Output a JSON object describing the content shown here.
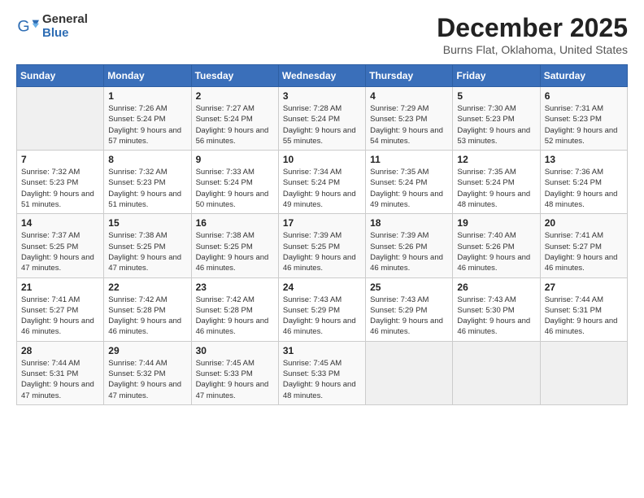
{
  "logo": {
    "general": "General",
    "blue": "Blue"
  },
  "title": "December 2025",
  "location": "Burns Flat, Oklahoma, United States",
  "days_of_week": [
    "Sunday",
    "Monday",
    "Tuesday",
    "Wednesday",
    "Thursday",
    "Friday",
    "Saturday"
  ],
  "weeks": [
    [
      {
        "day": "",
        "info": ""
      },
      {
        "day": "1",
        "info": "Sunrise: 7:26 AM\nSunset: 5:24 PM\nDaylight: 9 hours and 57 minutes."
      },
      {
        "day": "2",
        "info": "Sunrise: 7:27 AM\nSunset: 5:24 PM\nDaylight: 9 hours and 56 minutes."
      },
      {
        "day": "3",
        "info": "Sunrise: 7:28 AM\nSunset: 5:24 PM\nDaylight: 9 hours and 55 minutes."
      },
      {
        "day": "4",
        "info": "Sunrise: 7:29 AM\nSunset: 5:23 PM\nDaylight: 9 hours and 54 minutes."
      },
      {
        "day": "5",
        "info": "Sunrise: 7:30 AM\nSunset: 5:23 PM\nDaylight: 9 hours and 53 minutes."
      },
      {
        "day": "6",
        "info": "Sunrise: 7:31 AM\nSunset: 5:23 PM\nDaylight: 9 hours and 52 minutes."
      }
    ],
    [
      {
        "day": "7",
        "info": "Sunrise: 7:32 AM\nSunset: 5:23 PM\nDaylight: 9 hours and 51 minutes."
      },
      {
        "day": "8",
        "info": "Sunrise: 7:32 AM\nSunset: 5:23 PM\nDaylight: 9 hours and 51 minutes."
      },
      {
        "day": "9",
        "info": "Sunrise: 7:33 AM\nSunset: 5:24 PM\nDaylight: 9 hours and 50 minutes."
      },
      {
        "day": "10",
        "info": "Sunrise: 7:34 AM\nSunset: 5:24 PM\nDaylight: 9 hours and 49 minutes."
      },
      {
        "day": "11",
        "info": "Sunrise: 7:35 AM\nSunset: 5:24 PM\nDaylight: 9 hours and 49 minutes."
      },
      {
        "day": "12",
        "info": "Sunrise: 7:35 AM\nSunset: 5:24 PM\nDaylight: 9 hours and 48 minutes."
      },
      {
        "day": "13",
        "info": "Sunrise: 7:36 AM\nSunset: 5:24 PM\nDaylight: 9 hours and 48 minutes."
      }
    ],
    [
      {
        "day": "14",
        "info": "Sunrise: 7:37 AM\nSunset: 5:25 PM\nDaylight: 9 hours and 47 minutes."
      },
      {
        "day": "15",
        "info": "Sunrise: 7:38 AM\nSunset: 5:25 PM\nDaylight: 9 hours and 47 minutes."
      },
      {
        "day": "16",
        "info": "Sunrise: 7:38 AM\nSunset: 5:25 PM\nDaylight: 9 hours and 46 minutes."
      },
      {
        "day": "17",
        "info": "Sunrise: 7:39 AM\nSunset: 5:25 PM\nDaylight: 9 hours and 46 minutes."
      },
      {
        "day": "18",
        "info": "Sunrise: 7:39 AM\nSunset: 5:26 PM\nDaylight: 9 hours and 46 minutes."
      },
      {
        "day": "19",
        "info": "Sunrise: 7:40 AM\nSunset: 5:26 PM\nDaylight: 9 hours and 46 minutes."
      },
      {
        "day": "20",
        "info": "Sunrise: 7:41 AM\nSunset: 5:27 PM\nDaylight: 9 hours and 46 minutes."
      }
    ],
    [
      {
        "day": "21",
        "info": "Sunrise: 7:41 AM\nSunset: 5:27 PM\nDaylight: 9 hours and 46 minutes."
      },
      {
        "day": "22",
        "info": "Sunrise: 7:42 AM\nSunset: 5:28 PM\nDaylight: 9 hours and 46 minutes."
      },
      {
        "day": "23",
        "info": "Sunrise: 7:42 AM\nSunset: 5:28 PM\nDaylight: 9 hours and 46 minutes."
      },
      {
        "day": "24",
        "info": "Sunrise: 7:43 AM\nSunset: 5:29 PM\nDaylight: 9 hours and 46 minutes."
      },
      {
        "day": "25",
        "info": "Sunrise: 7:43 AM\nSunset: 5:29 PM\nDaylight: 9 hours and 46 minutes."
      },
      {
        "day": "26",
        "info": "Sunrise: 7:43 AM\nSunset: 5:30 PM\nDaylight: 9 hours and 46 minutes."
      },
      {
        "day": "27",
        "info": "Sunrise: 7:44 AM\nSunset: 5:31 PM\nDaylight: 9 hours and 46 minutes."
      }
    ],
    [
      {
        "day": "28",
        "info": "Sunrise: 7:44 AM\nSunset: 5:31 PM\nDaylight: 9 hours and 47 minutes."
      },
      {
        "day": "29",
        "info": "Sunrise: 7:44 AM\nSunset: 5:32 PM\nDaylight: 9 hours and 47 minutes."
      },
      {
        "day": "30",
        "info": "Sunrise: 7:45 AM\nSunset: 5:33 PM\nDaylight: 9 hours and 47 minutes."
      },
      {
        "day": "31",
        "info": "Sunrise: 7:45 AM\nSunset: 5:33 PM\nDaylight: 9 hours and 48 minutes."
      },
      {
        "day": "",
        "info": ""
      },
      {
        "day": "",
        "info": ""
      },
      {
        "day": "",
        "info": ""
      }
    ]
  ]
}
